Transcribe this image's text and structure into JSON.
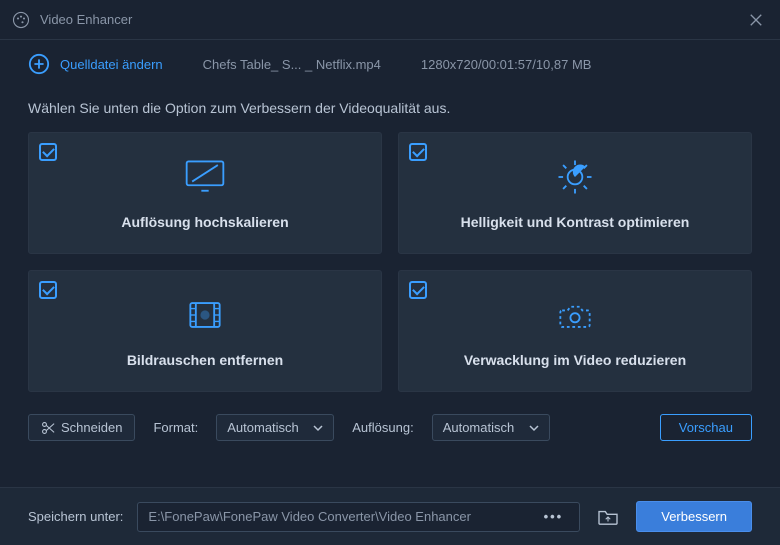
{
  "titlebar": {
    "title": "Video Enhancer"
  },
  "toolbar": {
    "change_source": "Quelldatei ändern",
    "filename": "Chefs Table_ S... _ Netflix.mp4",
    "fileinfo": "1280x720/00:01:57/10,87 MB"
  },
  "instruction": "Wählen Sie unten die Option zum Verbessern der Videoqualität aus.",
  "options": {
    "upscale": {
      "label": "Auflösung hochskalieren",
      "checked": true
    },
    "brightness": {
      "label": "Helligkeit und Kontrast optimieren",
      "checked": true
    },
    "denoise": {
      "label": "Bildrauschen entfernen",
      "checked": true
    },
    "stabilize": {
      "label": "Verwacklung im Video reduzieren",
      "checked": true
    }
  },
  "controls": {
    "cut": "Schneiden",
    "format_label": "Format:",
    "format_value": "Automatisch",
    "resolution_label": "Auflösung:",
    "resolution_value": "Automatisch",
    "preview": "Vorschau"
  },
  "bottom": {
    "save_label": "Speichern unter:",
    "path": "E:\\FonePaw\\FonePaw Video Converter\\Video Enhancer",
    "enhance": "Verbessern"
  },
  "colors": {
    "accent": "#3a9eff",
    "primary_btn": "#3a7edb"
  }
}
